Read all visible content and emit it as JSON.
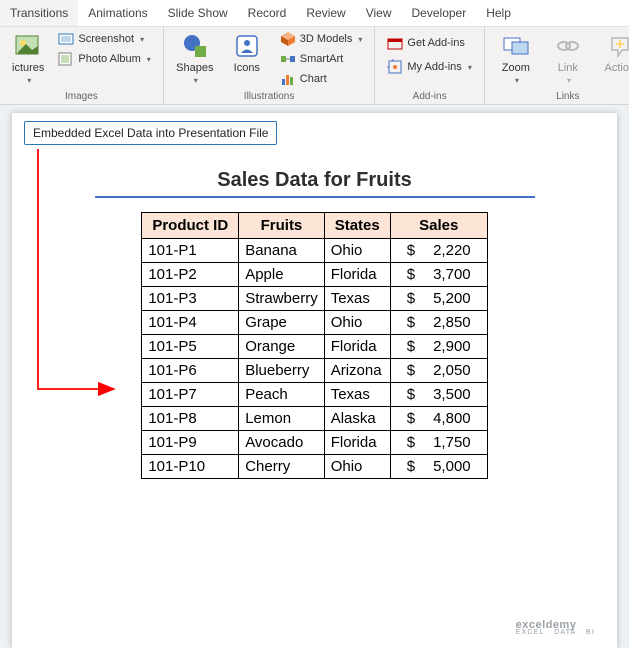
{
  "tabs": [
    "Transitions",
    "Animations",
    "Slide Show",
    "Record",
    "Review",
    "View",
    "Developer",
    "Help"
  ],
  "ribbon": {
    "images": {
      "label": "Images",
      "pictures": "ictures",
      "screenshot": "Screenshot",
      "photoalbum": "Photo Album"
    },
    "illustrations": {
      "label": "Illustrations",
      "shapes": "Shapes",
      "icons": "Icons",
      "models3d": "3D Models",
      "smartart": "SmartArt",
      "chart": "Chart"
    },
    "addins": {
      "label": "Add-ins",
      "get": "Get Add-ins",
      "my": "My Add-ins"
    },
    "links": {
      "label": "Links",
      "zoom": "Zoom",
      "link": "Link",
      "action": "Action"
    }
  },
  "callout": "Embedded Excel Data into Presentation File",
  "chart_data": {
    "type": "table",
    "title": "Sales Data for Fruits",
    "columns": [
      "Product ID",
      "Fruits",
      "States",
      "Sales"
    ],
    "rows": [
      {
        "id": "101-P1",
        "fruit": "Banana",
        "state": "Ohio",
        "sales": "2,220"
      },
      {
        "id": "101-P2",
        "fruit": "Apple",
        "state": "Florida",
        "sales": "3,700"
      },
      {
        "id": "101-P3",
        "fruit": "Strawberry",
        "state": "Texas",
        "sales": "5,200"
      },
      {
        "id": "101-P4",
        "fruit": "Grape",
        "state": "Ohio",
        "sales": "2,850"
      },
      {
        "id": "101-P5",
        "fruit": "Orange",
        "state": "Florida",
        "sales": "2,900"
      },
      {
        "id": "101-P6",
        "fruit": "Blueberry",
        "state": "Arizona",
        "sales": "2,050"
      },
      {
        "id": "101-P7",
        "fruit": "Peach",
        "state": "Texas",
        "sales": "3,500"
      },
      {
        "id": "101-P8",
        "fruit": "Lemon",
        "state": "Alaska",
        "sales": "4,800"
      },
      {
        "id": "101-P9",
        "fruit": "Avocado",
        "state": "Florida",
        "sales": "1,750"
      },
      {
        "id": "101-P10",
        "fruit": "Cherry",
        "state": "Ohio",
        "sales": "5,000"
      }
    ]
  },
  "watermark": {
    "main": "exceldemy",
    "sub": "EXCEL · DATA · BI"
  }
}
